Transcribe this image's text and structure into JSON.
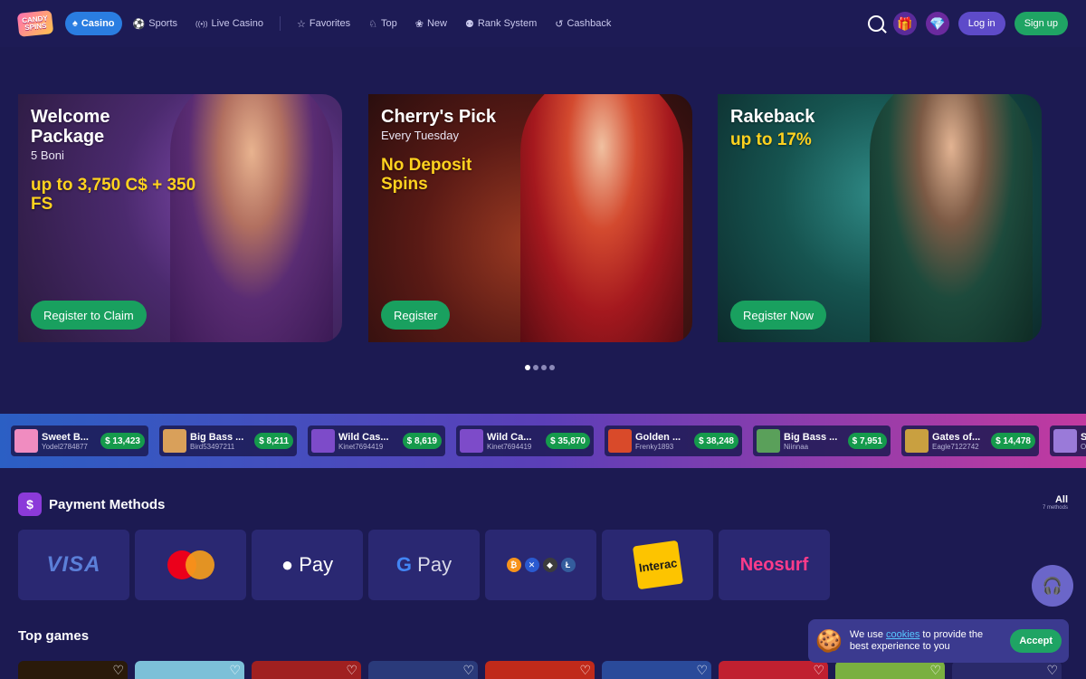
{
  "header": {
    "logo_text": "CANDY SPINS",
    "nav": [
      {
        "label": "Casino",
        "icon": "♠",
        "active": true
      },
      {
        "label": "Sports",
        "icon": "⚽"
      },
      {
        "label": "Live Casino",
        "icon": "((•))"
      },
      {
        "label": "Favorites",
        "icon": "☆"
      },
      {
        "label": "Top",
        "icon": "♘"
      },
      {
        "label": "New",
        "icon": "❀"
      },
      {
        "label": "Rank System",
        "icon": "⚉"
      },
      {
        "label": "Cashback",
        "icon": "↺"
      }
    ],
    "login_label": "Log in",
    "signup_label": "Sign up"
  },
  "banners": [
    {
      "title": "Welcome Package",
      "subtitle": "5 Boni",
      "highlight": "up to 3,750 C$ + 350 FS",
      "cta": "Register to Claim"
    },
    {
      "title": "Cherry's Pick",
      "subtitle": "Every Tuesday",
      "highlight": "No Deposit Spins",
      "cta": "Register"
    },
    {
      "title": "Rakeback",
      "highlight": "up to 17%",
      "cta": "Register Now"
    }
  ],
  "carousel": {
    "active_index": 0,
    "count": 4
  },
  "wins": [
    {
      "game": "Sweet B...",
      "user": "Yodel2784877",
      "amount": "$ 13,423",
      "color": "#f08cc0"
    },
    {
      "game": "Big Bass ...",
      "user": "Bird53497211",
      "amount": "$ 8,211",
      "color": "#d9a05a"
    },
    {
      "game": "Wild Cas...",
      "user": "Kinet7694419",
      "amount": "$ 8,619",
      "color": "#7d4bc9"
    },
    {
      "game": "Wild Ca...",
      "user": "Kinet7694419",
      "amount": "$ 35,870",
      "color": "#7d4bc9"
    },
    {
      "game": "Golden ...",
      "user": "Frenky1893",
      "amount": "$ 38,248",
      "color": "#d94a2a"
    },
    {
      "game": "Big Bass ...",
      "user": "Niinnaa",
      "amount": "$ 7,951",
      "color": "#5aa05a"
    },
    {
      "game": "Gates of...",
      "user": "Eagle7122742",
      "amount": "$ 14,478",
      "color": "#c9a040"
    },
    {
      "game": "Sug...",
      "user": "Optim...",
      "amount": "",
      "color": "#9a7ad9"
    }
  ],
  "payment": {
    "title": "Payment Methods",
    "all_label": "All",
    "count_label": "7 methods",
    "methods": [
      "VISA",
      "Mastercard",
      "Apple Pay",
      "Google Pay",
      "Crypto",
      "Interac",
      "Neosurf"
    ],
    "visa_text": "VISA",
    "applepay_text": " Pay",
    "gpay_g": "G",
    "gpay_text": " Pay",
    "interac_text": "Interac",
    "neosurf_text": "Neosurf"
  },
  "top_games": {
    "title": "Top games",
    "colors": [
      "#2a1a0a",
      "#7cc0d8",
      "#a02020",
      "#2a3a7a",
      "#c02a1a",
      "#2a4a9a",
      "#c02030",
      "#7ab040",
      "#2a2a6a"
    ]
  },
  "cookie": {
    "text_before": "We use ",
    "link": "cookies",
    "text_after": " to provide the best experience to you",
    "accept_label": "Accept"
  }
}
